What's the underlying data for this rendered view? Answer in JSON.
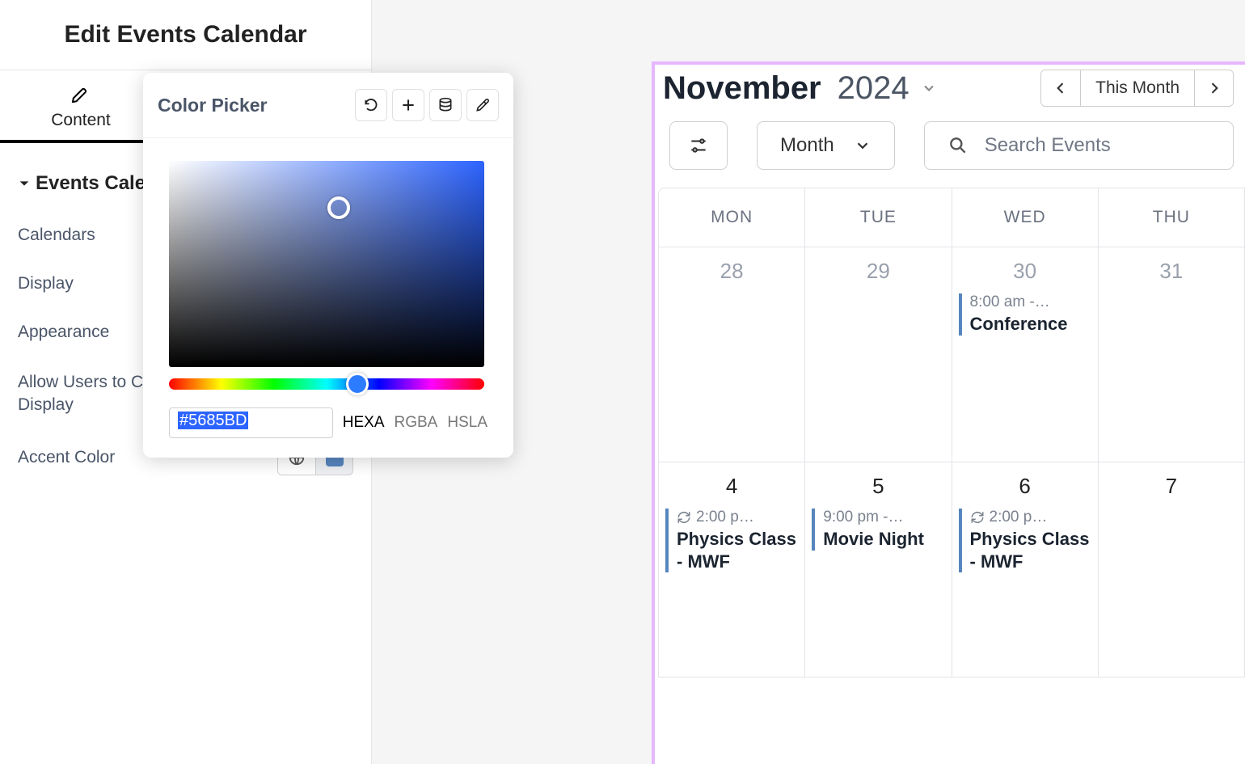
{
  "sidebar": {
    "title": "Edit Events Calendar",
    "tab_label": "Content",
    "section_title": "Events Cale",
    "items": [
      "Calendars",
      "Display",
      "Appearance",
      "Allow Users to Ch\nDisplay"
    ],
    "accent_label": "Accent Color"
  },
  "color_picker": {
    "title": "Color Picker",
    "hex_value": "#5685BD",
    "modes": [
      "HEXA",
      "RGBA",
      "HSLA"
    ],
    "active_mode": "HEXA"
  },
  "accent_color": "#5685BD",
  "calendar": {
    "month": "November",
    "year": "2024",
    "this_month_label": "This Month",
    "view_label": "Month",
    "search_placeholder": "Search Events",
    "days_of_week": [
      "MON",
      "TUE",
      "WED",
      "THU"
    ],
    "week1": [
      {
        "date": "28",
        "dim": true,
        "events": []
      },
      {
        "date": "29",
        "dim": true,
        "events": []
      },
      {
        "date": "30",
        "dim": true,
        "events": [
          {
            "time": "8:00 am -…",
            "title": "Conference",
            "recurring": false
          }
        ]
      },
      {
        "date": "31",
        "dim": true,
        "events": []
      }
    ],
    "week2": [
      {
        "date": "4",
        "dim": false,
        "events": [
          {
            "time": "2:00 p…",
            "title": "Physics Class - MWF",
            "recurring": true
          }
        ]
      },
      {
        "date": "5",
        "dim": false,
        "events": [
          {
            "time": "9:00 pm -…",
            "title": "Movie Night",
            "recurring": false
          }
        ]
      },
      {
        "date": "6",
        "dim": false,
        "events": [
          {
            "time": "2:00 p…",
            "title": "Physics Class - MWF",
            "recurring": true
          }
        ]
      },
      {
        "date": "7",
        "dim": false,
        "events": []
      }
    ]
  }
}
